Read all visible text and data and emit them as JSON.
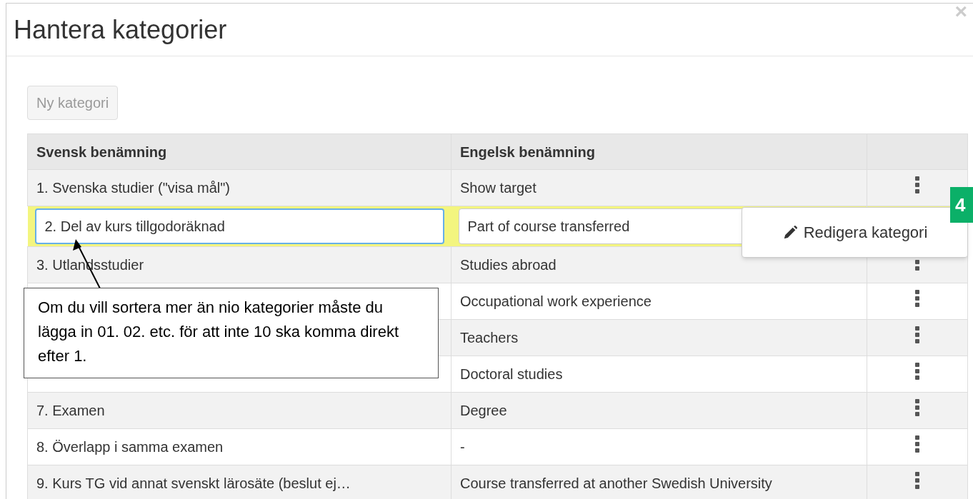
{
  "dialog": {
    "title": "Hantera kategorier",
    "close": "×"
  },
  "new_button": {
    "label": "Ny kategori",
    "disabled": true
  },
  "table": {
    "columns": [
      "Svensk benämning",
      "Engelsk benämning"
    ],
    "rows": [
      {
        "swedish": "1. Svenska studier (\"visa mål\")",
        "english": "Show target",
        "editing": false
      },
      {
        "swedish": "2. Del av kurs tillgodoräknad",
        "english": "Part of course transferred",
        "editing": true
      },
      {
        "swedish": "3. Utlandsstudier",
        "english": "Studies abroad",
        "editing": false
      },
      {
        "english": "Occupational work experience",
        "editing": false
      },
      {
        "english": "Teachers",
        "editing": false
      },
      {
        "english": "Doctoral studies",
        "editing": false
      },
      {
        "swedish": "7. Examen",
        "english": "Degree",
        "editing": false
      },
      {
        "swedish": "8. Överlapp i samma examen",
        "english": "-",
        "editing": false
      },
      {
        "swedish": "9. Kurs TG vid annat svenskt lärosäte (beslut ej…",
        "english": "Course transferred at another Swedish University",
        "editing": false
      }
    ]
  },
  "menu": {
    "items": [
      {
        "label": "Redigera kategori"
      }
    ]
  },
  "step_badge": "4",
  "callout": {
    "text": "Om du vill sortera mer än nio kategorier måste du lägga in 01. 02. etc. för att inte 10 ska komma direkt efter 1."
  }
}
